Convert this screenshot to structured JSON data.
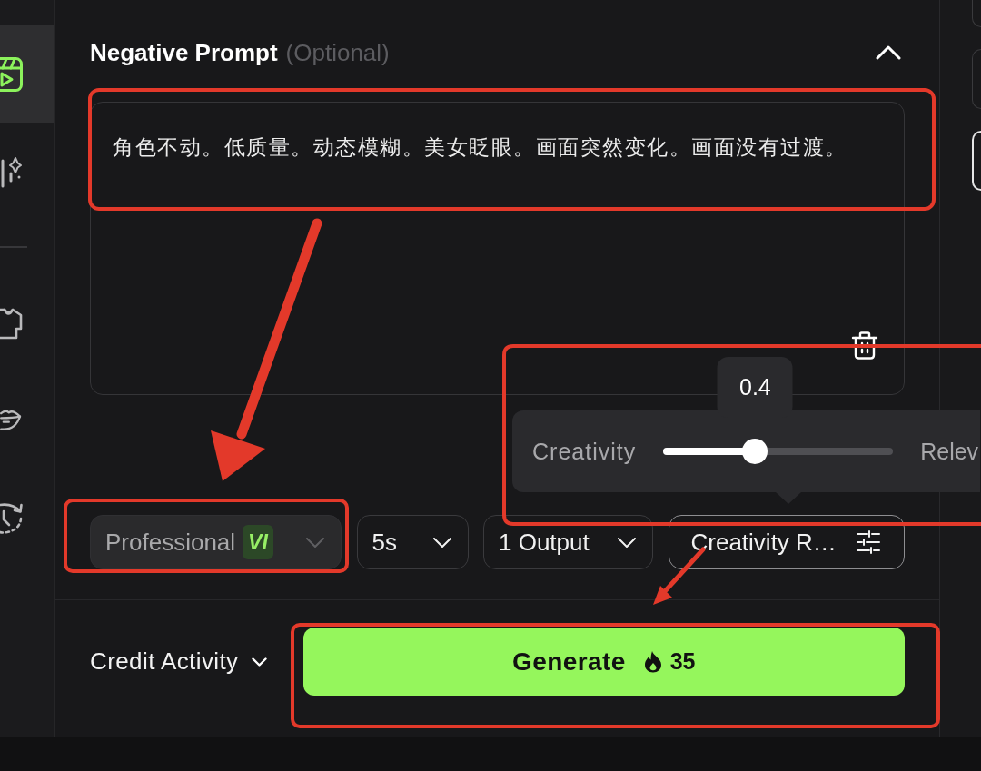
{
  "sidebar": {
    "items": [
      {
        "selected": true
      },
      {
        "selected": false
      },
      {
        "selected": false
      },
      {
        "selected": false
      },
      {
        "selected": false
      }
    ]
  },
  "negative_prompt": {
    "title": "Negative Prompt",
    "hint": "(Optional)",
    "expanded": true,
    "value": "角色不动。低质量。动态模糊。美女眨眼。画面突然变化。画面没有过渡。"
  },
  "creativity_popover": {
    "left_label": "Creativity",
    "right_label": "Relev",
    "level": 0.4,
    "reading": "0.4"
  },
  "options": [
    {
      "kind": "select",
      "label": "Professional",
      "badge": "VI",
      "disabled": true
    },
    {
      "kind": "select",
      "label": "5s",
      "disabled": false
    },
    {
      "kind": "select",
      "label": "1 Output",
      "disabled": false
    },
    {
      "kind": "button",
      "label": "Creativity R…",
      "disabled": false
    }
  ],
  "footer": {
    "credit": {
      "label": "Credit Activity",
      "expanded": false
    },
    "generate": {
      "label": "Generate",
      "cost": "35"
    }
  },
  "right_panel": {
    "cards": [
      {
        "selected": false
      },
      {
        "selected": false
      },
      {
        "selected": true
      }
    ]
  }
}
